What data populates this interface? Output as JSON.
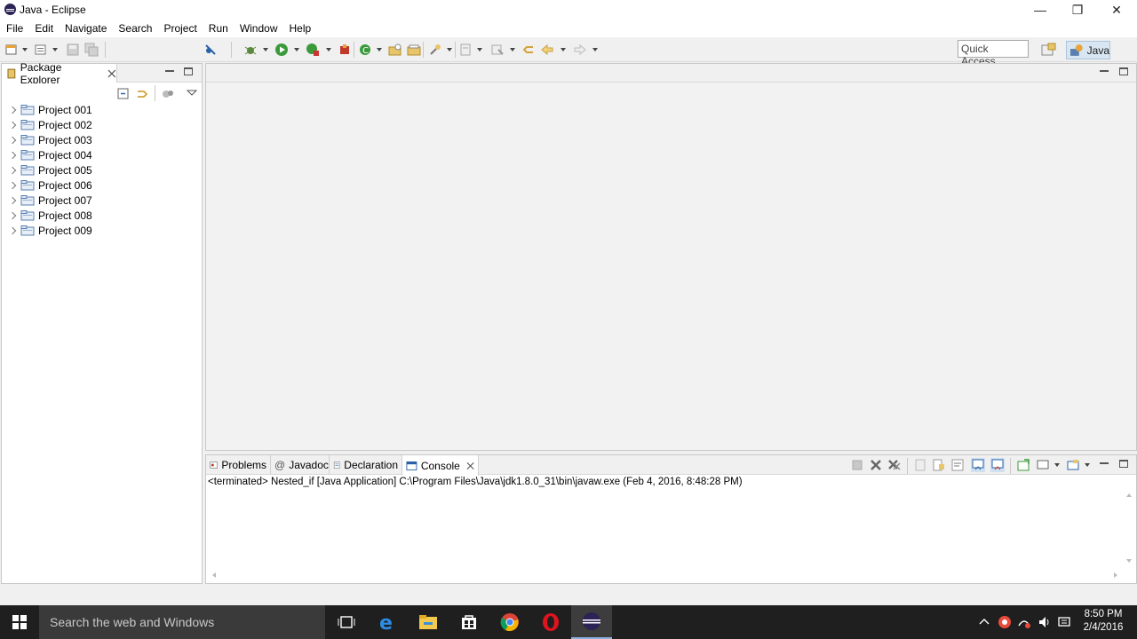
{
  "window": {
    "title": "Java - Eclipse",
    "minimize_glyph": "—",
    "restore_glyph": "❐",
    "close_glyph": "✕"
  },
  "menu": [
    "File",
    "Edit",
    "Navigate",
    "Search",
    "Project",
    "Run",
    "Window",
    "Help"
  ],
  "toolbar": {
    "quick_access_placeholder": "Quick Access",
    "perspective_label": "Java",
    "icons": [
      "new-wizard-icon",
      "new-icon",
      "save-icon",
      "save-all-icon",
      "skip-breakpoints-icon",
      "debug-icon",
      "run-icon",
      "run-coverage-icon",
      "external-tools-icon",
      "new-java-project-icon",
      "new-package-icon",
      "new-class-icon",
      "open-type-icon",
      "open-task-icon",
      "search-icon",
      "next-annotation-icon",
      "prev-annotation-icon",
      "last-edit-icon",
      "back-icon",
      "forward-icon"
    ]
  },
  "package_explorer": {
    "tab_label": "Package Explorer",
    "projects": [
      {
        "label": "Project 001"
      },
      {
        "label": "Project 002"
      },
      {
        "label": "Project 003"
      },
      {
        "label": "Project 004"
      },
      {
        "label": "Project 005"
      },
      {
        "label": "Project 006"
      },
      {
        "label": "Project 007"
      },
      {
        "label": "Project 008"
      },
      {
        "label": "Project 009"
      }
    ]
  },
  "console": {
    "tabs": [
      {
        "label": "Problems",
        "icon": "problems-icon"
      },
      {
        "label": "Javadoc",
        "icon": "javadoc-icon"
      },
      {
        "label": "Declaration",
        "icon": "declaration-icon"
      },
      {
        "label": "Console",
        "icon": "console-icon",
        "active": true
      }
    ],
    "status": "<terminated> Nested_if [Java Application] C:\\Program Files\\Java\\jdk1.8.0_31\\bin\\javaw.exe (Feb 4, 2016, 8:48:28 PM)"
  },
  "taskbar": {
    "search_placeholder": "Search the web and Windows",
    "apps": [
      "task-view-icon",
      "edge-icon",
      "file-explorer-icon",
      "store-icon",
      "chrome-icon",
      "opera-icon",
      "eclipse-icon"
    ],
    "tray_icons": [
      "tray-chevron-icon",
      "tray-app-icon",
      "network-icon",
      "volume-icon",
      "notifications-icon"
    ],
    "time": "8:50 PM",
    "date": "2/4/2016"
  },
  "colors": {
    "accent": "#8bb4e0",
    "taskbar": "#1f1f1f",
    "perspective_active": "#d8e6f2"
  }
}
